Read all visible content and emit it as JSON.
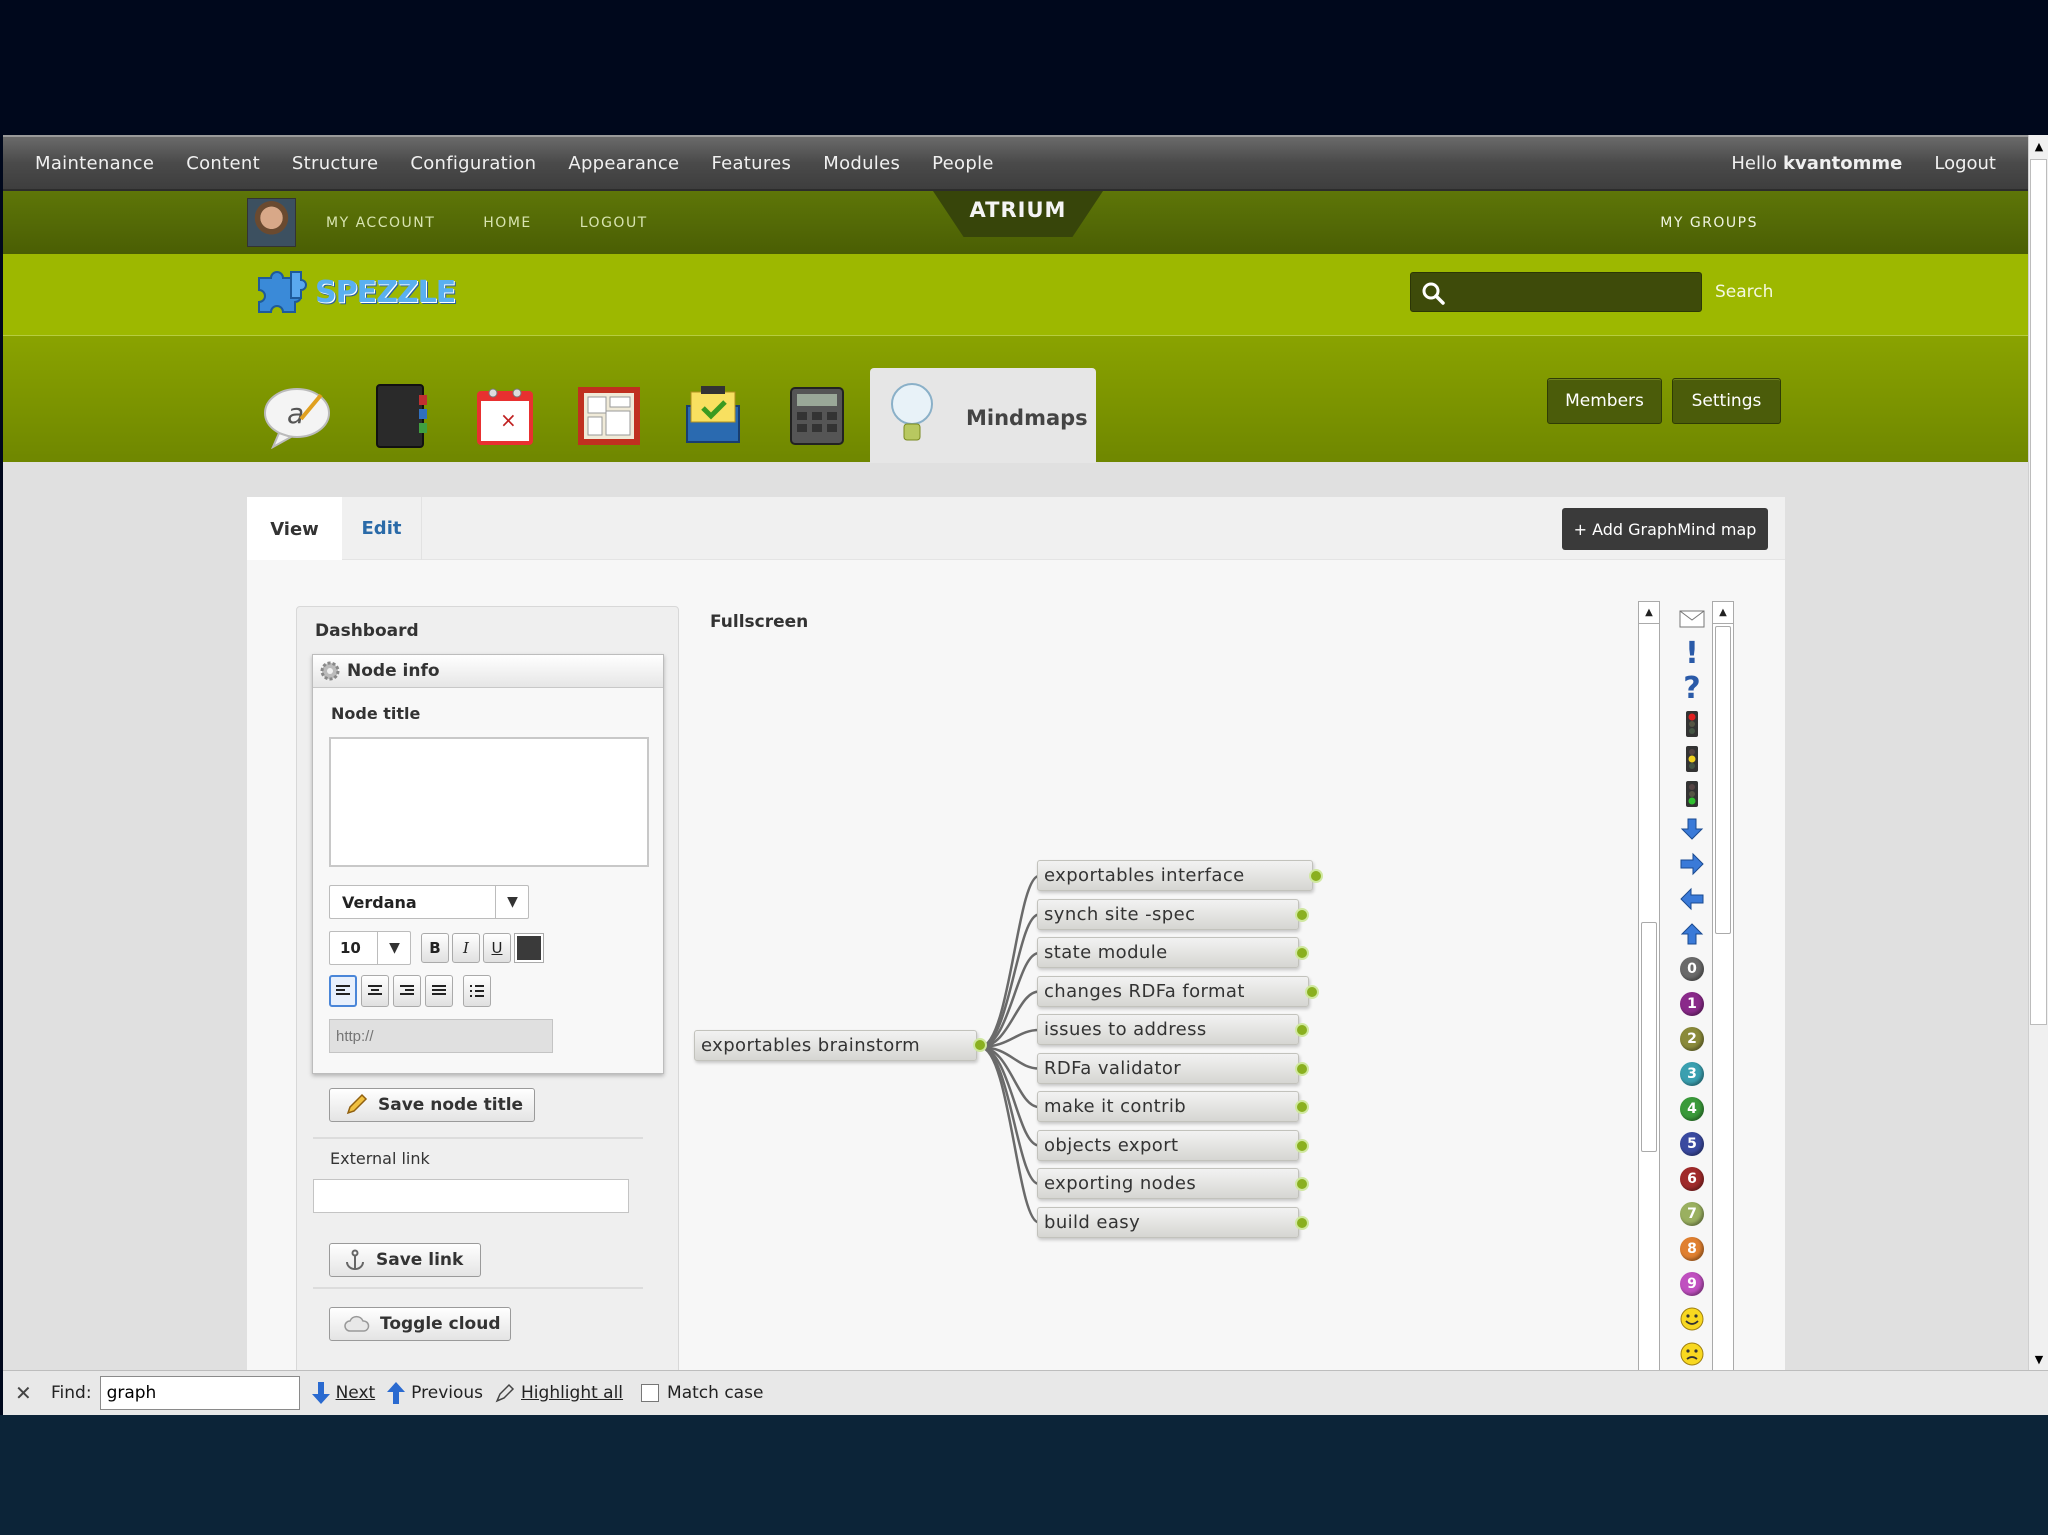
{
  "admin_menu": [
    "Maintenance",
    "Content",
    "Structure",
    "Configuration",
    "Appearance",
    "Features",
    "Modules",
    "People"
  ],
  "admin_right": {
    "hello": "Hello",
    "username": "kvantomme",
    "logout": "Logout"
  },
  "user_links": [
    "MY ACCOUNT",
    "HOME",
    "LOGOUT"
  ],
  "atrium_label": "ATRIUM",
  "my_groups": "MY GROUPS",
  "site_name": "SPEZZLE",
  "search": {
    "value": "",
    "button": "Search"
  },
  "apps": [
    {
      "icon": "blog-icon"
    },
    {
      "icon": "notebook-icon"
    },
    {
      "icon": "calendar-icon"
    },
    {
      "icon": "dashboard-icon"
    },
    {
      "icon": "todo-icon"
    },
    {
      "icon": "calculator-icon"
    }
  ],
  "active_app": "Mindmaps",
  "group_buttons": {
    "members": "Members",
    "settings": "Settings"
  },
  "tabs": {
    "view": "View",
    "edit": "Edit"
  },
  "add_button": "+ Add GraphMind map",
  "dashboard": {
    "title": "Dashboard",
    "node_info": "Node info",
    "node_title_label": "Node title",
    "node_title_value": "",
    "font": "Verdana",
    "font_size": "10",
    "bold": "B",
    "italic": "I",
    "underline": "U",
    "text_color": "#3a3a3a",
    "url_placeholder": "http://",
    "save_title": "Save node title",
    "external_link_label": "External link",
    "external_link_value": "",
    "save_link": "Save link",
    "toggle_cloud": "Toggle cloud"
  },
  "fullscreen": "Fullscreen",
  "mindmap": {
    "root": "exportables brainstorm",
    "children": [
      "exportables interface",
      "synch site -spec",
      "state module",
      "changes RDFa format",
      "issues to address",
      "RDFa validator",
      "make it contrib",
      "objects export",
      "exporting nodes",
      "build easy"
    ]
  },
  "icon_palette": [
    {
      "icon": "envelope-icon"
    },
    {
      "icon": "exclamation-icon",
      "glyph": "!"
    },
    {
      "icon": "question-icon",
      "glyph": "?"
    },
    {
      "icon": "traffic-light-red-icon"
    },
    {
      "icon": "traffic-light-yellow-icon"
    },
    {
      "icon": "traffic-light-green-icon"
    },
    {
      "icon": "arrow-down-icon"
    },
    {
      "icon": "arrow-right-icon"
    },
    {
      "icon": "arrow-left-icon"
    },
    {
      "icon": "arrow-up-icon"
    },
    {
      "icon": "priority-0-icon",
      "glyph": "0",
      "color": "#6a6a6a"
    },
    {
      "icon": "priority-1-icon",
      "glyph": "1",
      "color": "#8a2a8a"
    },
    {
      "icon": "priority-2-icon",
      "glyph": "2",
      "color": "#8a8a3a"
    },
    {
      "icon": "priority-3-icon",
      "glyph": "3",
      "color": "#3aa0b0"
    },
    {
      "icon": "priority-4-icon",
      "glyph": "4",
      "color": "#3a9a3a"
    },
    {
      "icon": "priority-5-icon",
      "glyph": "5",
      "color": "#3a4aa0"
    },
    {
      "icon": "priority-6-icon",
      "glyph": "6",
      "color": "#a02a2a"
    },
    {
      "icon": "priority-7-icon",
      "glyph": "7",
      "color": "#9ab060"
    },
    {
      "icon": "priority-8-icon",
      "glyph": "8",
      "color": "#e08030"
    },
    {
      "icon": "priority-9-icon",
      "glyph": "9",
      "color": "#c050c0"
    },
    {
      "icon": "smiley-happy-icon"
    },
    {
      "icon": "smiley-neutral-icon"
    }
  ],
  "findbar": {
    "label": "Find:",
    "value": "graph",
    "next": "Next",
    "previous": "Previous",
    "highlight_all": "Highlight all",
    "match_case": "Match case"
  },
  "colors": {
    "accent": "#9db800",
    "dark_green": "#4a5e04",
    "link": "#2a6aa8"
  }
}
